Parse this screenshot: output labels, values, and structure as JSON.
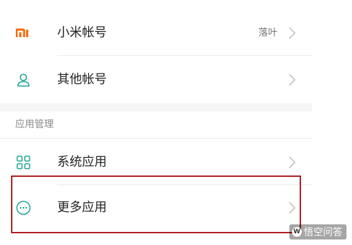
{
  "accounts": {
    "mi_account": {
      "label": "小米帐号",
      "value": "落叶",
      "icon": "mi-logo-icon"
    },
    "other_account": {
      "label": "其他帐号",
      "icon": "person-icon"
    }
  },
  "app_management": {
    "section_title": "应用管理",
    "items": [
      {
        "label": "系统应用",
        "icon": "grid-apps-icon"
      },
      {
        "label": "更多应用",
        "icon": "more-circle-icon"
      }
    ]
  },
  "watermark": {
    "text": "悟空问答"
  },
  "colors": {
    "mi_orange": "#ff6700",
    "accent_teal": "#1aa58f",
    "highlight_red": "#b01a1a"
  }
}
